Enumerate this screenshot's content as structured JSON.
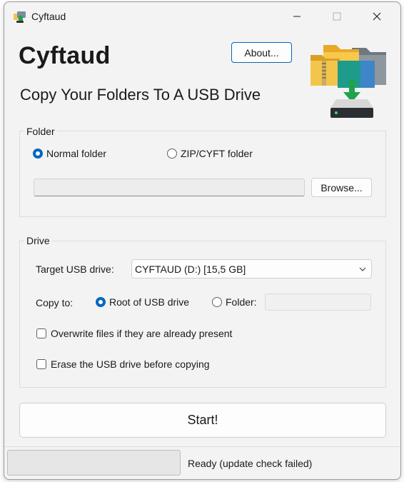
{
  "window": {
    "title": "Cyftaud",
    "icon": "cyftaud-app-icon"
  },
  "header": {
    "app_name": "Cyftaud",
    "subtitle": "Copy Your Folders To A USB Drive",
    "about_label": "About..."
  },
  "folder_group": {
    "legend": "Folder",
    "options": [
      {
        "label": "Normal folder",
        "selected": true
      },
      {
        "label": "ZIP/CYFT folder",
        "selected": false
      }
    ],
    "path_value": "",
    "browse_label": "Browse..."
  },
  "drive_group": {
    "legend": "Drive",
    "target_label": "Target USB drive:",
    "target_value": "CYFTAUD (D:) [15,5 GB]",
    "copy_to_label": "Copy to:",
    "copy_options": [
      {
        "label": "Root of USB drive",
        "selected": true
      },
      {
        "label": "Folder:",
        "selected": false
      }
    ],
    "folder_value": "",
    "overwrite_label": "Overwrite files if they are already present",
    "overwrite_checked": false,
    "erase_label": "Erase the USB drive before copying",
    "erase_checked": false
  },
  "actions": {
    "start_label": "Start!"
  },
  "status": {
    "text": "Ready (update check failed)",
    "progress": 0
  },
  "colors": {
    "accent": "#0067c0",
    "window_bg": "#f3f3f3",
    "usb_green": "#1ea34a"
  }
}
